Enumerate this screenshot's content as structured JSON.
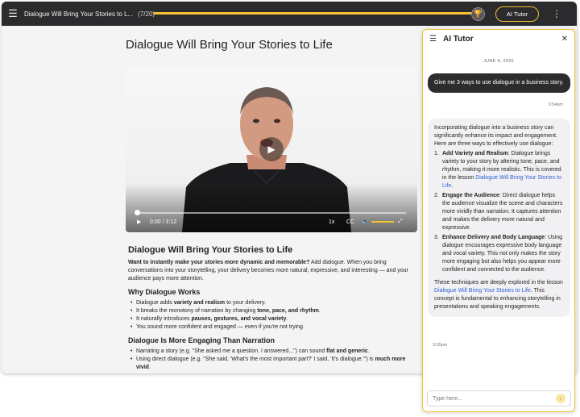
{
  "topbar": {
    "course_title": "Dialogue Will Bring Your Stories to L...",
    "lesson_count": "(7/20)",
    "progress_fraction": 1.0,
    "ai_button_label": "AI Tutor",
    "accent_color": "#f2c230"
  },
  "lesson": {
    "title": "Dialogue Will Bring Your Stories to Life"
  },
  "video": {
    "time": "0:00 / 3:12",
    "speed": "1x",
    "cc_label": "CC"
  },
  "article": {
    "heading": "Dialogue Will Bring Your Stories to Life",
    "intro_bold": "Want to instantly make your stories more dynamic and memorable?",
    "intro_rest": " Add dialogue. When you bring conversations into your storytelling, your delivery becomes more natural, expressive, and interesting — and your audience pays more attention.",
    "section1_heading": "Why Dialogue Works",
    "section1_items": [
      {
        "pre": "Dialogue adds ",
        "bold": "variety and realism",
        "post": " to your delivery."
      },
      {
        "pre": "It breaks the monotony of narration by changing ",
        "bold": "tone, pace, and rhythm",
        "post": "."
      },
      {
        "pre": "It naturally introduces ",
        "bold": "pauses, gestures, and vocal variety",
        "post": "."
      },
      {
        "pre": "You sound more confident and engaged — even if you're not trying.",
        "bold": "",
        "post": ""
      }
    ],
    "section2_heading": "Dialogue Is More Engaging Than Narration",
    "section2_items": [
      {
        "pre": "Narrating a story (e.g. \"She asked me a question. I answered...\") can sound ",
        "bold": "flat and generic",
        "post": "."
      },
      {
        "pre": "Using direct dialogue (e.g. \"She said, 'What's the most important part?' I said, 'It's dialogue.'\") is ",
        "bold": "much more vivid",
        "post": "."
      }
    ]
  },
  "tutor": {
    "title": "AI Tutor",
    "date": "JUNE 4, 2025",
    "user_message": "Give me 3 ways to use dialogue in a business story.",
    "user_time": "3:54pm",
    "bot_intro": "Incorporating dialogue into a business story can significantly enhance its impact and engagement. Here are three ways to effectively use dialogue:",
    "bot_items": [
      {
        "num": "1.",
        "bold": "Add Variety and Realism",
        "text": ": Dialogue brings variety to your story by altering tone, pace, and rhythm, making it more realistic. This is covered in the lesson ",
        "link": "Dialogue Will Bring Your Stories to Life",
        "after": "."
      },
      {
        "num": "2.",
        "bold": "Engage the Audience",
        "text": ": Direct dialogue helps the audience visualize the scene and characters more vividly than narration. It captures attention and makes the delivery more natural and expressive.",
        "link": "",
        "after": ""
      },
      {
        "num": "3.",
        "bold": "Enhance Delivery and Body Language",
        "text": ": Using dialogue encourages expressive body language and vocal variety. This not only makes the story more engaging but also helps you appear more confident and connected to the audience.",
        "link": "",
        "after": ""
      }
    ],
    "bot_outro_pre": "These techniques are deeply explored in the lesson ",
    "bot_outro_link": "Dialogue Will Bring Your Stories to Life",
    "bot_outro_post": ". This concept is fundamental to enhancing storytelling in presentations and speaking engagements.",
    "bot_time": "3:55pm",
    "input_placeholder": "Type here..."
  }
}
